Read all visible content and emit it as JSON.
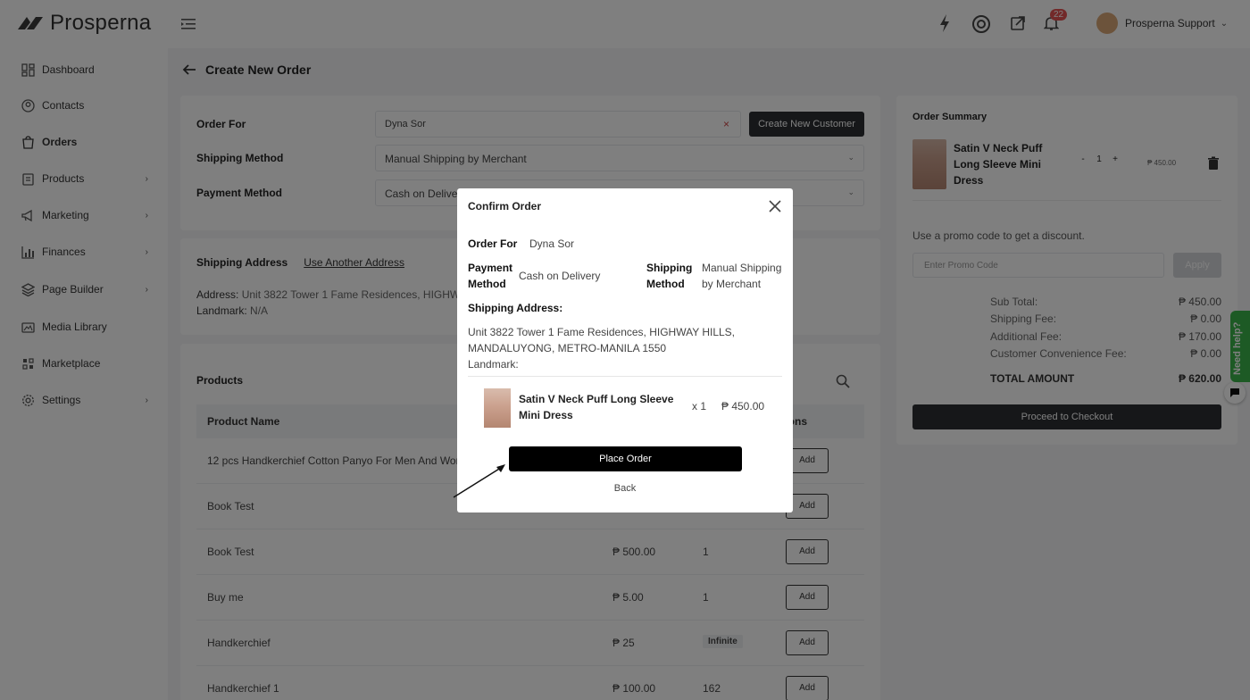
{
  "brand": {
    "name": "Prosperna"
  },
  "header": {
    "notification_count": "22",
    "user_name": "Prosperna Support"
  },
  "sidebar": {
    "items": [
      {
        "label": "Dashboard",
        "icon": "dashboard-icon",
        "chevron": false
      },
      {
        "label": "Contacts",
        "icon": "contacts-icon",
        "chevron": false
      },
      {
        "label": "Orders",
        "icon": "orders-icon",
        "chevron": false
      },
      {
        "label": "Products",
        "icon": "products-icon",
        "chevron": true
      },
      {
        "label": "Marketing",
        "icon": "megaphone-icon",
        "chevron": true
      },
      {
        "label": "Finances",
        "icon": "chart-icon",
        "chevron": true
      },
      {
        "label": "Page Builder",
        "icon": "layers-icon",
        "chevron": true
      },
      {
        "label": "Media Library",
        "icon": "media-icon",
        "chevron": false
      },
      {
        "label": "Marketplace",
        "icon": "marketplace-icon",
        "chevron": false
      },
      {
        "label": "Settings",
        "icon": "gear-icon",
        "chevron": true
      }
    ]
  },
  "page": {
    "title": "Create New Order"
  },
  "order_form": {
    "order_for_label": "Order For",
    "order_for_value": "Dyna Sor",
    "clear_glyph": "×",
    "create_customer_label": "Create New Customer",
    "shipping_method_label": "Shipping Method",
    "shipping_method_value": "Manual Shipping by Merchant",
    "payment_method_label": "Payment Method",
    "payment_method_value": "Cash on Delivery"
  },
  "shipping_address": {
    "label": "Shipping Address",
    "link": "Use Another Address",
    "address_label": "Address:",
    "address_value": "Unit 3822 Tower 1 Fame Residences, HIGHWAY HILLS, MANDALUYONG, METRO-MANILA 1550",
    "landmark_label": "Landmark:",
    "landmark_value": "N/A"
  },
  "products": {
    "title": "Products",
    "columns": {
      "name": "Product Name",
      "actions": "Actions"
    },
    "add_label": "Add",
    "rows": [
      {
        "name": "12 pcs Handkerchief Cotton Panyo For Men And Women",
        "price": "",
        "stock": "",
        "infinite": false
      },
      {
        "name": "Book Test",
        "price": "",
        "stock": "",
        "infinite": false
      },
      {
        "name": "Book Test",
        "price": "₱ 500.00",
        "stock": "1",
        "infinite": false
      },
      {
        "name": "Buy me",
        "price": "₱ 5.00",
        "stock": "1",
        "infinite": false
      },
      {
        "name": "Handkerchief",
        "price": "₱ 25",
        "stock": "Infinite",
        "infinite": true
      },
      {
        "name": "Handkerchief 1",
        "price": "₱ 100.00",
        "stock": "162",
        "infinite": false
      }
    ]
  },
  "order_summary": {
    "title": "Order Summary",
    "product_name": "Satin V Neck Puff Long Sleeve Mini Dress",
    "minus": "-",
    "qty": "1",
    "plus": "+",
    "price": "₱ 450.00",
    "promo_text": "Use a promo code to get a discount.",
    "promo_placeholder": "Enter Promo Code",
    "apply_label": "Apply",
    "fees": [
      {
        "label": "Sub Total:",
        "value": "₱ 450.00",
        "total": false
      },
      {
        "label": "Shipping Fee:",
        "value": "₱ 0.00",
        "total": false
      },
      {
        "label": "Additional Fee:",
        "value": "₱ 170.00",
        "total": false
      },
      {
        "label": "Customer Convenience Fee:",
        "value": "₱ 0.00",
        "total": false
      },
      {
        "label": "TOTAL AMOUNT",
        "value": "₱ 620.00",
        "total": true
      }
    ],
    "checkout_label": "Proceed to Checkout"
  },
  "help": {
    "label": "Need help?"
  },
  "modal": {
    "title": "Confirm Order",
    "order_for_label": "Order For",
    "order_for_value": "Dyna Sor",
    "payment_label": "Payment Method",
    "payment_value": "Cash on Delivery",
    "shipping_label": "Shipping Method",
    "shipping_value": "Manual Shipping by Merchant",
    "address_label": "Shipping Address:",
    "address_value": "Unit 3822 Tower 1 Fame Residences, HIGHWAY HILLS, MANDALUYONG, METRO-MANILA 1550",
    "landmark_label": "Landmark:",
    "product_name": "Satin V Neck Puff Long Sleeve Mini Dress",
    "qty": "x 1",
    "price": "₱ 450.00",
    "place_order_label": "Place Order",
    "back_label": "Back"
  },
  "colors": {
    "overlay": "#000000",
    "primary_button": "#2c2f33",
    "help_tab": "#3bb44a",
    "badge": "#e55353"
  }
}
